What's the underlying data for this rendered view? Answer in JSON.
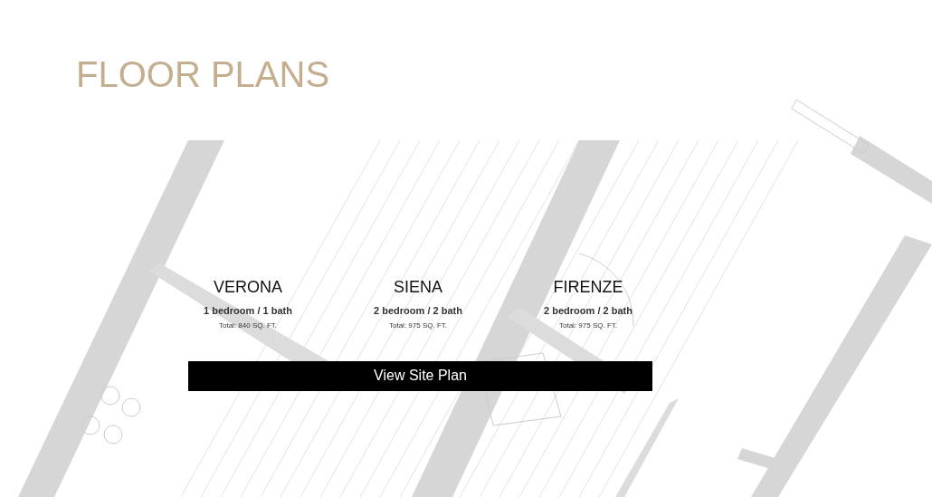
{
  "heading": "FLOOR PLANS",
  "plans": [
    {
      "name": "VERONA",
      "rooms": "1 bedroom / 1 bath",
      "total": "Total: 840 SQ. FT."
    },
    {
      "name": "SIENA",
      "rooms": "2 bedroom / 2 bath",
      "total": "Total: 975 SQ. FT."
    },
    {
      "name": "FIRENZE",
      "rooms": "2 bedroom / 2 bath",
      "total": "Total: 975 SQ. FT."
    }
  ],
  "button": "View Site Plan"
}
